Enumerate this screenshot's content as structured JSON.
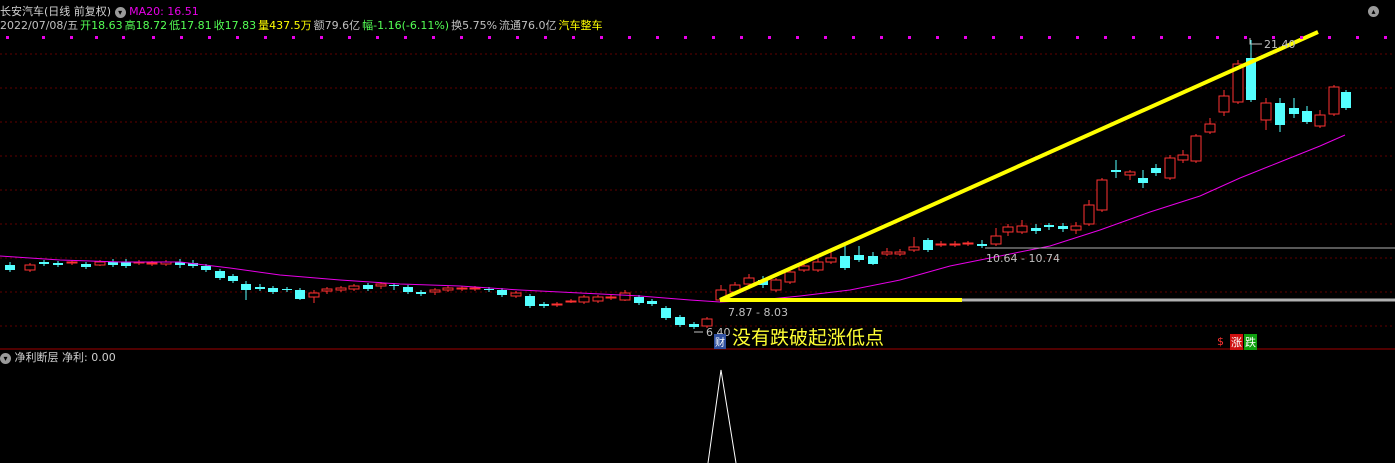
{
  "header": {
    "title": "长安汽车(日线 前复权)",
    "ma_label": "MA20: 16.51",
    "date": "2022/07/08/五",
    "open": "开18.63",
    "high": "高18.72",
    "low": "低17.81",
    "close": "收17.83",
    "volume": "量437.5万",
    "amount": "额79.6亿",
    "change": "幅-1.16(-6.11%)",
    "turnover": "换5.75%",
    "float": "流通76.0亿",
    "sector": "汽车整车"
  },
  "annotations": {
    "high_label": "21.40",
    "low_label": "6.40",
    "range1": "7.87 - 8.03",
    "range2": "10.64 - 10.74",
    "note": "没有跌破起涨低点",
    "cai": "财",
    "dollar": "$",
    "zhang": "涨",
    "die": "跌"
  },
  "sub_panel": {
    "title": "净利断层",
    "value_label": "净利: 0.00"
  },
  "colors": {
    "up": "#ff3232",
    "down": "#54ffff",
    "ma": "#e800e8",
    "trend": "#ffff00",
    "grid": "#800000",
    "support": "#c0c0c0"
  },
  "chart_data": {
    "type": "candlestick",
    "ma_period": 20,
    "ma_last": 16.51,
    "last_bar": {
      "date": "2022/07/08",
      "open": 18.63,
      "high": 18.72,
      "low": 17.81,
      "close": 17.83
    },
    "marked_high": 21.4,
    "marked_low": 6.4,
    "ranges": [
      "7.87 - 8.03",
      "10.64 - 10.74"
    ]
  }
}
